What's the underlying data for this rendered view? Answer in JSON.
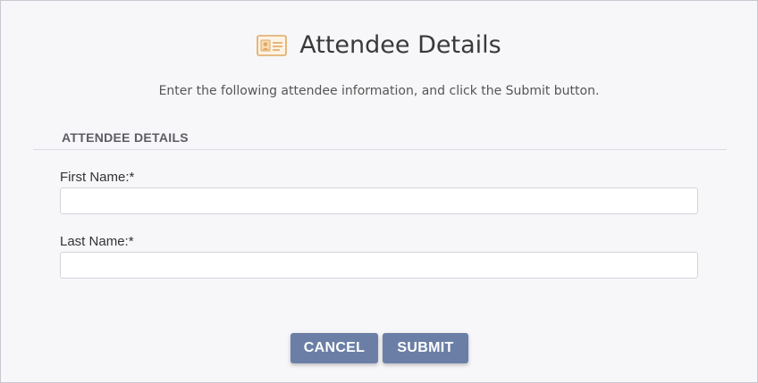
{
  "dialog": {
    "title": "Attendee Details",
    "title_icon": "id-card-icon",
    "instruction": "Enter the following attendee information, and click the Submit button."
  },
  "section": {
    "title": "ATTENDEE DETAILS"
  },
  "fields": {
    "first_name": {
      "label": "First Name:*",
      "value": "",
      "placeholder": ""
    },
    "last_name": {
      "label": "Last Name:*",
      "value": "",
      "placeholder": ""
    }
  },
  "buttons": {
    "cancel": "CANCEL",
    "submit": "SUBMIT"
  },
  "colors": {
    "button_bg": "#6b7fa6",
    "icon_accent": "#e0a860"
  }
}
